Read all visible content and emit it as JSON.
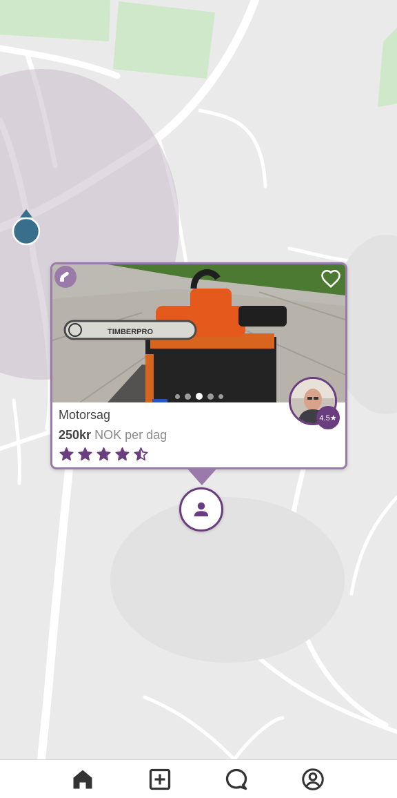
{
  "listing": {
    "title": "Motorsag",
    "price_amount": "250kr",
    "price_unit": "NOK per dag",
    "rating_stars": 4.5,
    "owner_rating": "4.5★",
    "photo_count": 5,
    "active_photo_index": 2,
    "photo_brand_text": "TIMBERPRO"
  },
  "colors": {
    "accent": "#6a3c80",
    "accent_light": "#9a7aa8",
    "location_dot": "#3a6f8b"
  },
  "icons": {
    "category": "chainsaw-icon",
    "favorite": "heart-outline-icon",
    "marker": "person-icon",
    "nav": [
      "home-icon",
      "add-box-icon",
      "chat-bubble-icon",
      "account-circle-icon"
    ]
  }
}
